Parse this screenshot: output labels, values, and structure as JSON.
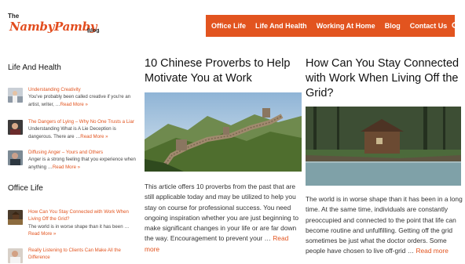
{
  "site": {
    "logo_the": "The",
    "logo_name": "NambyPamby",
    "logo_blog": "Blog"
  },
  "nav": {
    "items": [
      "Office Life",
      "Life And Health",
      "Working At Home",
      "Blog",
      "Contact Us"
    ],
    "search_icon": "search-icon",
    "bg_color": "#e2541f"
  },
  "sidebar": {
    "sections": [
      {
        "title": "Life And Health",
        "items": [
          {
            "title": "Understanding Creativity",
            "excerpt": "You've probably been called creative if you're an artist, writer, …",
            "more": "Read More »"
          },
          {
            "title": "The Dangers of Lying – Why No One Trusts a Liar",
            "excerpt": "Understanding What is A Lie Deception is dangerous. There are …",
            "more": "Read More »"
          },
          {
            "title": "Diffusing Anger – Yours and Others",
            "excerpt": "Anger is a strong feeling that you experience when anything …",
            "more": "Read More »"
          }
        ]
      },
      {
        "title": "Office Life",
        "items": [
          {
            "title": "How Can You Stay Connected with Work When Living Off the Grid?",
            "excerpt": "The world is in worse shape than it has been …",
            "more": "Read More »"
          },
          {
            "title": "Really Listening to Clients Can Make All the Difference",
            "excerpt": "",
            "more": ""
          }
        ]
      }
    ]
  },
  "articles": [
    {
      "title": "10 Chinese Proverbs to Help Motivate You at Work",
      "body": "This article offers 10 proverbs from the past that are still applicable today and may be utilized to help you stay on course for professional success. You need ongoing inspiration whether you are just beginning to make significant changes in your life or are far down the way. Encouragement to prevent your …",
      "more": "Read more"
    },
    {
      "title": "How Can You Stay Connected with Work When Living Off the Grid?",
      "body": "The world is in worse shape than it has been in a long time. At the same time, individuals are constantly preoccupied and connected to the point that life can become routine and unfulfilling. Getting off the grid sometimes be just what the doctor orders. Some people have chosen to live off-grid …",
      "more": "Read more"
    }
  ],
  "colors": {
    "accent": "#e2541f",
    "text": "#333333"
  }
}
